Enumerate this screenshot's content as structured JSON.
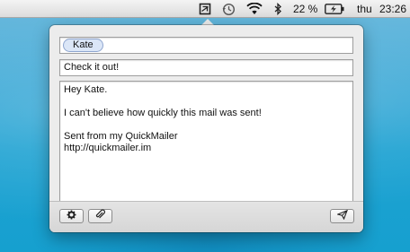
{
  "menubar": {
    "icons": [
      "quickmailer-icon",
      "time-machine-icon",
      "wifi-icon",
      "bluetooth-icon",
      "battery-charging-icon"
    ],
    "battery_percent": "22 %",
    "day": "thu",
    "time": "23:26"
  },
  "mail": {
    "recipient": "Kate",
    "subject": "Check it out!",
    "body_lines": [
      "Hey Kate.",
      "",
      "I can't believe how quickly this mail was sent!",
      "",
      "Sent from my QuickMailer",
      "http://quickmailer.im"
    ]
  },
  "toolbar": {
    "buttons": [
      "settings-gear-icon",
      "attachment-paperclip-icon",
      "send-paper-plane-icon"
    ]
  }
}
